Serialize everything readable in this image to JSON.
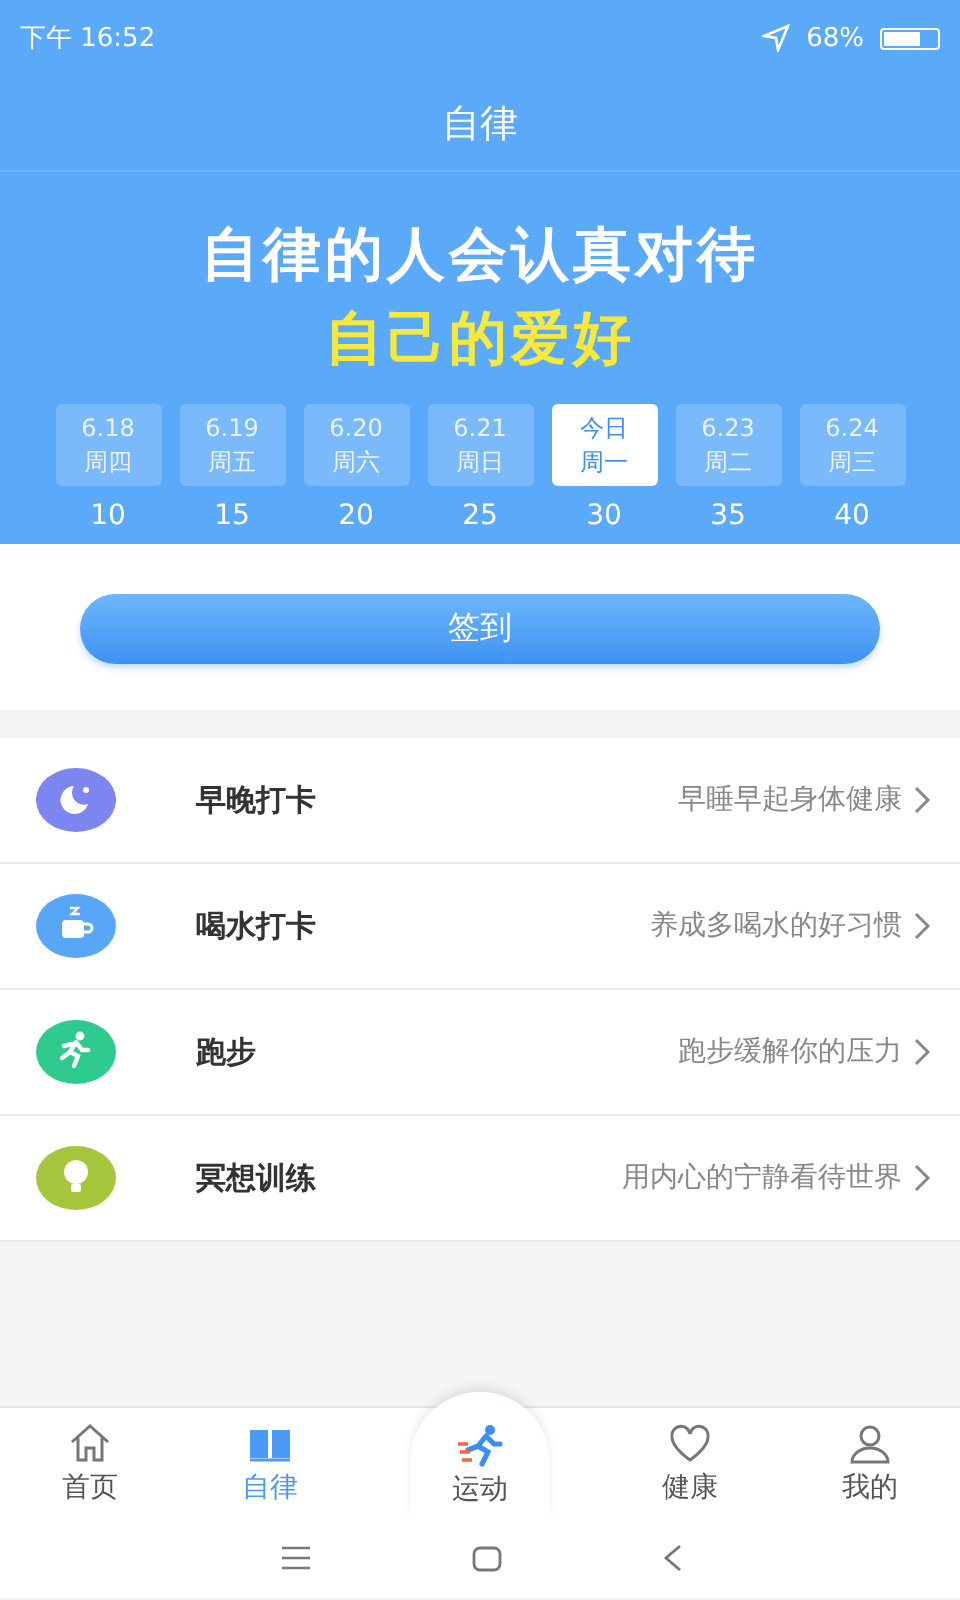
{
  "status_bar": {
    "time": "下午 16:52",
    "battery_text": "68%"
  },
  "title": "自律",
  "banner": {
    "headline": "自律的人会认真对待",
    "highlight": "自己的爱好"
  },
  "days": [
    {
      "date": "6.18",
      "weekday": "周四",
      "points": "10",
      "selected": false
    },
    {
      "date": "6.19",
      "weekday": "周五",
      "points": "15",
      "selected": false
    },
    {
      "date": "6.20",
      "weekday": "周六",
      "points": "20",
      "selected": false
    },
    {
      "date": "6.21",
      "weekday": "周日",
      "points": "25",
      "selected": false
    },
    {
      "date": "今日",
      "weekday": "周一",
      "points": "30",
      "selected": true
    },
    {
      "date": "6.23",
      "weekday": "周二",
      "points": "35",
      "selected": false
    },
    {
      "date": "6.24",
      "weekday": "周三",
      "points": "40",
      "selected": false
    }
  ],
  "checkin_button": "签到",
  "tasks": [
    {
      "kind": "moon",
      "name": "早晚打卡",
      "hint": "早睡早起身体健康",
      "color": "#7d86f0"
    },
    {
      "kind": "cup",
      "name": "喝水打卡",
      "hint": "养成多喝水的好习惯",
      "color": "#58a6f6"
    },
    {
      "kind": "run",
      "name": "跑步",
      "hint": "跑步缓解你的压力",
      "color": "#2fcb8e"
    },
    {
      "kind": "bulb",
      "name": "冥想训练",
      "hint": "用内心的宁静看待世界",
      "color": "#a5c63c"
    }
  ],
  "tabs": [
    {
      "kind": "home",
      "label": "首页",
      "selected": false
    },
    {
      "kind": "book",
      "label": "自律",
      "selected": true
    },
    {
      "kind": "sport",
      "label": "运动",
      "selected": false
    },
    {
      "kind": "heart",
      "label": "健康",
      "selected": false
    },
    {
      "kind": "user",
      "label": "我的",
      "selected": false
    }
  ]
}
